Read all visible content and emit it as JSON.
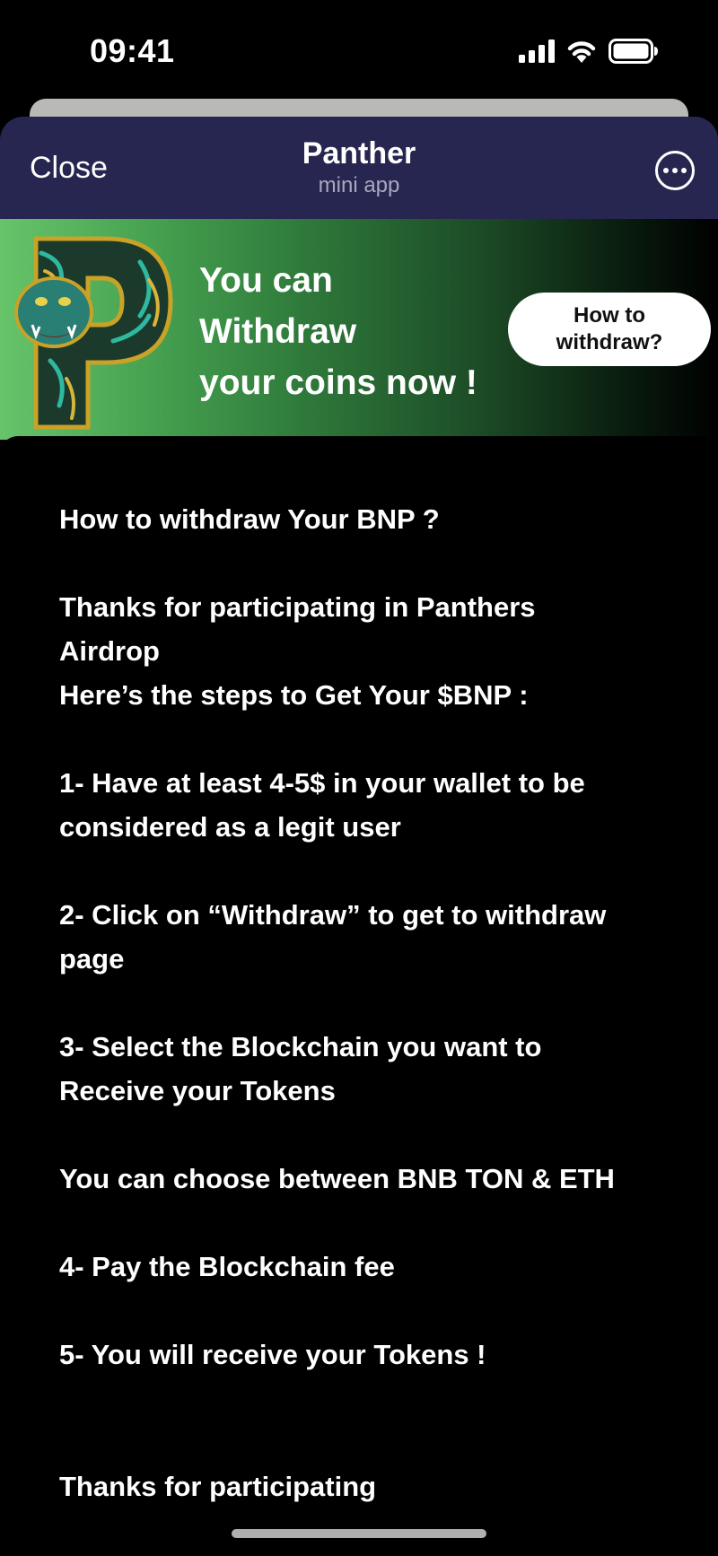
{
  "status_bar": {
    "time": "09:41"
  },
  "header": {
    "close_label": "Close",
    "title": "Panther",
    "subtitle": "mini app"
  },
  "banner": {
    "line1": "You can",
    "line2": "Withdraw",
    "line3": "your coins now !",
    "button_line1": "How to",
    "button_line2": "withdraw?"
  },
  "content": {
    "heading": "How to withdraw Your BNP ?",
    "thanks_intro_1": "Thanks for participating in Panthers",
    "thanks_intro_2": "Airdrop",
    "steps_intro": "Here’s the steps to Get Your $BNP :",
    "step1_line1": "1- Have at least 4-5$ in your wallet to be",
    "step1_line2": "considered as a legit user",
    "step2_line1": "2- Click on “Withdraw” to get to withdraw",
    "step2_line2": "page",
    "step3_line1": "3- Select the Blockchain you want to",
    "step3_line2": "Receive your Tokens",
    "choose": "You can choose between BNB TON & ETH",
    "step4": "4- Pay the Blockchain fee",
    "step5": "5- You will receive your Tokens !",
    "closing": "Thanks for participating"
  },
  "colors": {
    "header_bg": "#272650",
    "banner_start": "#67c46a",
    "banner_end": "#000000"
  }
}
